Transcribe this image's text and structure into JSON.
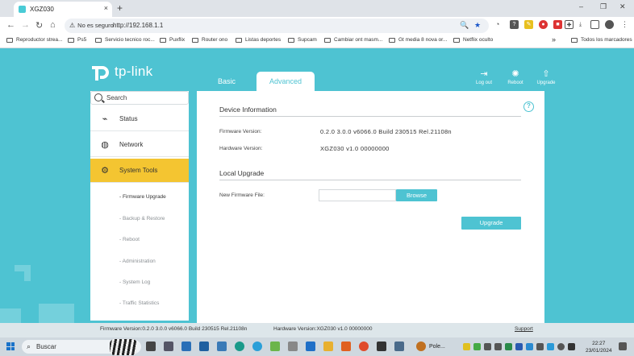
{
  "browser": {
    "tab_title": "XGZ030",
    "tab_close": "×",
    "new_tab": "+",
    "window_controls": [
      "–",
      "❐",
      "✕"
    ],
    "security_label": "No es seguro",
    "url": "http://192.168.1.1",
    "bookmarks": [
      "Reproductor strea...",
      "Ps5",
      "Servicio tecnico roc...",
      "Puxflix",
      "Router ono",
      "Listas deportes",
      "Supcam",
      "Cambiar ont masm...",
      "Gt media 8 nova or...",
      "Netflix oculto"
    ],
    "bookmarks_overflow": "»",
    "all_bookmarks": "Todos los marcadores"
  },
  "router": {
    "brand": "tp-link",
    "modes": {
      "basic": "Basic",
      "advanced": "Advanced"
    },
    "top_actions": {
      "logout": "Log out",
      "reboot": "Reboot",
      "upgrade": "Upgrade"
    },
    "search_placeholder": "Search",
    "menu": [
      {
        "label": "Status",
        "icon": "pulse-icon"
      },
      {
        "label": "Network",
        "icon": "globe-icon"
      },
      {
        "label": "System Tools",
        "icon": "gear-icon"
      }
    ],
    "submenu": [
      "- Firmware Upgrade",
      "- Backup & Restore",
      "- Reboot",
      "- Administration",
      "- System Log",
      "- Traffic Statistics"
    ],
    "device_info": {
      "title": "Device Information",
      "firmware_label": "Firmware Version:",
      "firmware_value": "0.2.0 3.0.0 v6066.0 Build 230515 Rel.21108n",
      "hardware_label": "Hardware Version:",
      "hardware_value": "XGZ030 v1.0 00000000"
    },
    "local_upgrade": {
      "title": "Local Upgrade",
      "file_label": "New Firmware File:",
      "browse": "Browse",
      "upgrade": "Upgrade"
    },
    "footer": {
      "firmware": "Firmware Version:0.2.0 3.0.0 v6066.0 Build 230515 Rel.21108n",
      "hardware": "Hardware Version:XGZ030 v1.0 00000000",
      "support": "Support"
    },
    "colors": {
      "accent": "#4ec3d2",
      "active_menu": "#f4c531"
    }
  },
  "taskbar": {
    "search": "Buscar",
    "app_label": "Pole...",
    "time": "22:27",
    "date": "23/01/2024"
  }
}
